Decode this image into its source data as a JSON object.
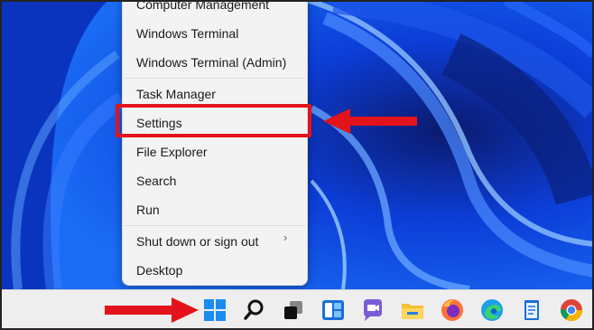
{
  "menu": {
    "items": [
      {
        "label": "Computer Management"
      },
      {
        "label": "Windows Terminal"
      },
      {
        "label": "Windows Terminal (Admin)"
      },
      {
        "label": "Task Manager"
      },
      {
        "label": "Settings"
      },
      {
        "label": "File Explorer"
      },
      {
        "label": "Search"
      },
      {
        "label": "Run"
      },
      {
        "label": "Shut down or sign out",
        "chevron": "›"
      },
      {
        "label": "Desktop"
      }
    ]
  },
  "taskbar": {
    "icons": [
      "start-icon",
      "search-icon",
      "task-view-icon",
      "widgets-icon",
      "chat-icon",
      "file-explorer-icon",
      "firefox-icon",
      "edge-icon",
      "notepad-icon",
      "chrome-icon"
    ]
  },
  "colors": {
    "highlight": "#e3131b",
    "wallpaper": "#0a3fd6",
    "menu_bg": "#f3f3f3"
  }
}
